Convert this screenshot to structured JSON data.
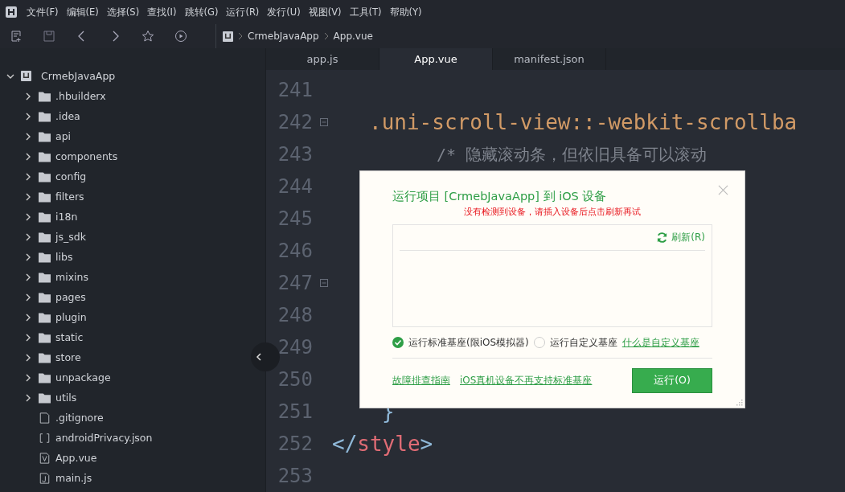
{
  "menu": [
    "文件(F)",
    "编辑(E)",
    "选择(S)",
    "查找(I)",
    "跳转(G)",
    "运行(R)",
    "发行(U)",
    "视图(V)",
    "工具(T)",
    "帮助(Y)"
  ],
  "breadcrumb": [
    "CrmebJavaApp",
    "App.vue"
  ],
  "sidebar": {
    "root": {
      "label": "CrmebJavaApp",
      "expanded": true,
      "children": [
        {
          "label": ".hbuilderx",
          "kind": "folder",
          "expanded": false
        },
        {
          "label": ".idea",
          "kind": "folder",
          "expanded": false
        },
        {
          "label": "api",
          "kind": "folder",
          "expanded": false
        },
        {
          "label": "components",
          "kind": "folder",
          "expanded": false
        },
        {
          "label": "config",
          "kind": "folder",
          "expanded": false
        },
        {
          "label": "filters",
          "kind": "folder",
          "expanded": false
        },
        {
          "label": "i18n",
          "kind": "folder",
          "expanded": false
        },
        {
          "label": "js_sdk",
          "kind": "folder",
          "expanded": false
        },
        {
          "label": "libs",
          "kind": "folder",
          "expanded": false
        },
        {
          "label": "mixins",
          "kind": "folder",
          "expanded": false
        },
        {
          "label": "pages",
          "kind": "folder",
          "expanded": false
        },
        {
          "label": "plugin",
          "kind": "folder",
          "expanded": false
        },
        {
          "label": "static",
          "kind": "folder",
          "expanded": false
        },
        {
          "label": "store",
          "kind": "folder",
          "expanded": false
        },
        {
          "label": "unpackage",
          "kind": "folder",
          "expanded": false
        },
        {
          "label": "utils",
          "kind": "folder",
          "expanded": false
        },
        {
          "label": ".gitignore",
          "kind": "file"
        },
        {
          "label": "androidPrivacy.json",
          "kind": "json"
        },
        {
          "label": "App.vue",
          "kind": "vue"
        },
        {
          "label": "main.js",
          "kind": "js"
        }
      ]
    }
  },
  "tabs": [
    {
      "label": "app.js",
      "selected": false
    },
    {
      "label": "App.vue",
      "selected": true
    },
    {
      "label": "manifest.json",
      "selected": false
    }
  ],
  "code": [
    {
      "number": "241",
      "fold": false
    },
    {
      "number": "242",
      "fold": true,
      "segments": [
        {
          "text": ".uni-scroll-view::-webkit-scrollba",
          "kind": "selector"
        }
      ]
    },
    {
      "number": "243",
      "fold": false,
      "segments": [
        {
          "text": "/* 隐藏滚动条，但依旧具备可以滚动",
          "kind": "comment"
        }
      ]
    },
    {
      "number": "244",
      "fold": false
    },
    {
      "number": "245",
      "fold": false
    },
    {
      "number": "246",
      "fold": false
    },
    {
      "number": "247",
      "fold": true
    },
    {
      "number": "248",
      "fold": false
    },
    {
      "number": "249",
      "fold": false
    },
    {
      "number": "250",
      "fold": false
    },
    {
      "number": "251",
      "fold": false,
      "segments": [
        {
          "text": "}",
          "kind": "brace"
        }
      ]
    },
    {
      "number": "252",
      "fold": false,
      "segments": [
        {
          "text": "</",
          "kind": "punct"
        },
        {
          "text": "style",
          "kind": "tag"
        },
        {
          "text": ">",
          "kind": "punct"
        }
      ]
    },
    {
      "number": "253",
      "fold": false
    }
  ],
  "dialog": {
    "title": "运行项目 [CrmebJavaApp] 到 iOS 设备",
    "error": "没有检测到设备，请插入设备后点击刷新再试",
    "refresh": "刷新(R)",
    "options": [
      {
        "label": "运行标准基座(限iOS模拟器)",
        "selected": true
      },
      {
        "label": "运行自定义基座",
        "selected": false
      }
    ],
    "help_link": "什么是自定义基座",
    "footer_links": [
      "故障排查指南",
      "iOS真机设备不再支持标准基座"
    ],
    "run_button": "运行(O)"
  }
}
